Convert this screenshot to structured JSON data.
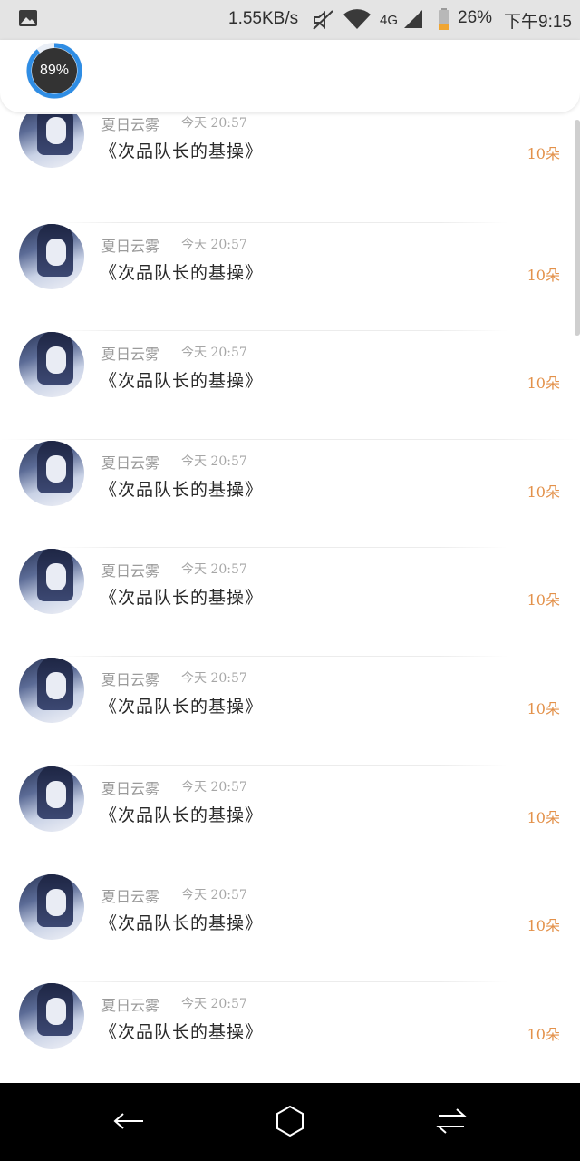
{
  "status_bar": {
    "net_rate": "1.55KB/s",
    "network": "4G",
    "battery": "26%",
    "time": "下午9:15",
    "icons": [
      "gallery-icon",
      "mute-icon",
      "wifi-icon",
      "signal-icon",
      "battery-icon"
    ]
  },
  "header": {
    "progress_label": "89%",
    "progress_value": 0.89
  },
  "list": [
    {
      "author": "夏日云雾",
      "time": "今天 20:57",
      "title": "《次品队长的基操》",
      "count": "10朵"
    },
    {
      "author": "夏日云雾",
      "time": "今天 20:57",
      "title": "《次品队长的基操》",
      "count": "10朵"
    },
    {
      "author": "夏日云雾",
      "time": "今天 20:57",
      "title": "《次品队长的基操》",
      "count": "10朵"
    },
    {
      "author": "夏日云雾",
      "time": "今天 20:57",
      "title": "《次品队长的基操》",
      "count": "10朵"
    },
    {
      "author": "夏日云雾",
      "time": "今天 20:57",
      "title": "《次品队长的基操》",
      "count": "10朵"
    },
    {
      "author": "夏日云雾",
      "time": "今天 20:57",
      "title": "《次品队长的基操》",
      "count": "10朵"
    },
    {
      "author": "夏日云雾",
      "time": "今天 20:57",
      "title": "《次品队长的基操》",
      "count": "10朵"
    },
    {
      "author": "夏日云雾",
      "time": "今天 20:57",
      "title": "《次品队长的基操》",
      "count": "10朵"
    },
    {
      "author": "夏日云雾",
      "time": "今天 20:57",
      "title": "《次品队长的基操》",
      "count": "10朵"
    }
  ],
  "colors": {
    "count": "#e3914a",
    "progress_ring": "#2f8de4"
  },
  "nav": [
    "back-icon",
    "home-icon",
    "recents-icon"
  ]
}
